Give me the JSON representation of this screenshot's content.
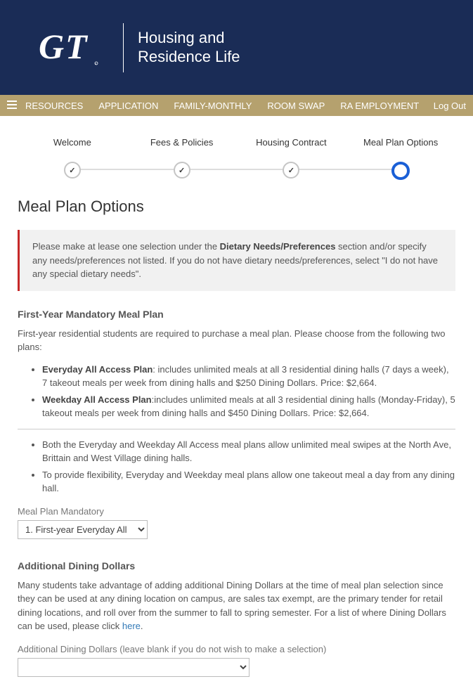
{
  "header": {
    "logo_text_line1": "Housing and",
    "logo_text_line2": "Residence Life"
  },
  "nav": {
    "items": [
      "RESOURCES",
      "APPLICATION",
      "FAMILY-MONTHLY",
      "ROOM SWAP",
      "RA EMPLOYMENT"
    ],
    "logout": "Log Out"
  },
  "stepper": {
    "steps": [
      "Welcome",
      "Fees & Policies",
      "Housing Contract",
      "Meal Plan Options"
    ]
  },
  "page_title": "Meal Plan Options",
  "alert": {
    "pre": "Please make at lease one selection under the ",
    "bold": "Dietary Needs/Preferences",
    "post": " section and/or specify any needs/preferences not listed. If you do not have dietary needs/preferences, select \"I do not have any special dietary needs\"."
  },
  "first_year": {
    "title": "First-Year Mandatory Meal Plan",
    "intro": "First-year residential students are required to purchase a meal plan. Please choose from the following two plans:",
    "plans": [
      {
        "name": "Everyday All Access Plan",
        "desc": ": includes unlimited meals at all 3 residential dining halls (7 days a week), 7 takeout meals per week from dining halls and $250 Dining Dollars. Price: $2,664."
      },
      {
        "name": "Weekday All Access Plan",
        "desc": ":includes unlimited meals at all 3 residential dining halls (Monday-Friday), 5 takeout meals per week from dining halls and $450 Dining Dollars. Price: $2,664."
      }
    ],
    "notes": [
      "Both the Everyday and Weekday All Access meal plans allow unlimited meal swipes at the North Ave, Brittain and West Village dining halls.",
      "To provide flexibility, Everyday and Weekday meal plans allow one takeout meal a day from any dining hall."
    ],
    "select_label": "Meal Plan Mandatory",
    "select_value": "1. First-year Everyday All"
  },
  "dining_dollars": {
    "title": "Additional Dining Dollars",
    "text_pre": "Many students take advantage of adding additional Dining Dollars at the time of meal plan selection since they can be used at any dining location on campus, are sales tax exempt, are the primary tender for retail dining locations, and roll over from the summer to fall to spring semester. For a list of where Dining Dollars can be used, please click ",
    "link": "here",
    "text_post": ".",
    "select_label": "Additional Dining Dollars (leave blank if you do not wish to make a selection)",
    "select_value": ""
  }
}
